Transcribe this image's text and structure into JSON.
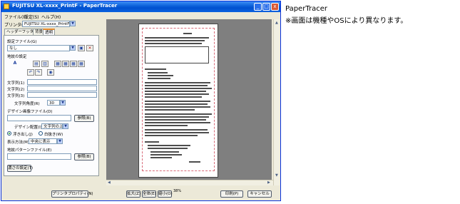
{
  "window": {
    "title": "FUJITSU XL-xxxx_PrintF - PaperTracer",
    "controls": {
      "minimize": "_",
      "maximize": "□",
      "close": "x"
    }
  },
  "menu": [
    "ファイル(F)",
    "設定(S)",
    "ヘルプ(H)"
  ],
  "printer": {
    "label": "プリンタ(P)",
    "value": "FUJITSU XL-xxxx_PrintF"
  },
  "tabs": [
    "ヘッダーフッター",
    "背景",
    "透明"
  ],
  "panel": {
    "settings_file_label": "設定ファイル(G)",
    "settings_file_value": "なし",
    "pattern_label": "地紋の設定",
    "text_labels": [
      "文字列(1)",
      "文字列(2)",
      "文字列(3)"
    ],
    "text_angle_label": "文字列角度(R)",
    "text_angle_value": "30",
    "design_file_label": "デザイン画像ファイル(D)",
    "browse1": "参照(B)",
    "design_layout_label": "デザイン配置(I)",
    "design_layout_value": "文字列の上",
    "radio_options": [
      "浮き出し(J)",
      "白抜き(W)"
    ],
    "display_method_label": "表示方法(M)",
    "display_method_value": "中央に表示",
    "pattern_file_label": "地紋パターンファイル(E)",
    "browse2": "参照(B)",
    "detail_button": "濃さの設定(T)"
  },
  "bottom_bar": {
    "printer_properties": "プリンタプロパティ(N)",
    "zoom_in": "拡大(Z)",
    "fit_all": "全体(E)",
    "zoom_out": "縮小(O)",
    "zoom_level": "38%",
    "print": "印刷(P)",
    "cancel": "キャンセル"
  },
  "side_caption": {
    "title": "PaperTracer",
    "note": "※画面は機種やOSにより異なります。"
  }
}
